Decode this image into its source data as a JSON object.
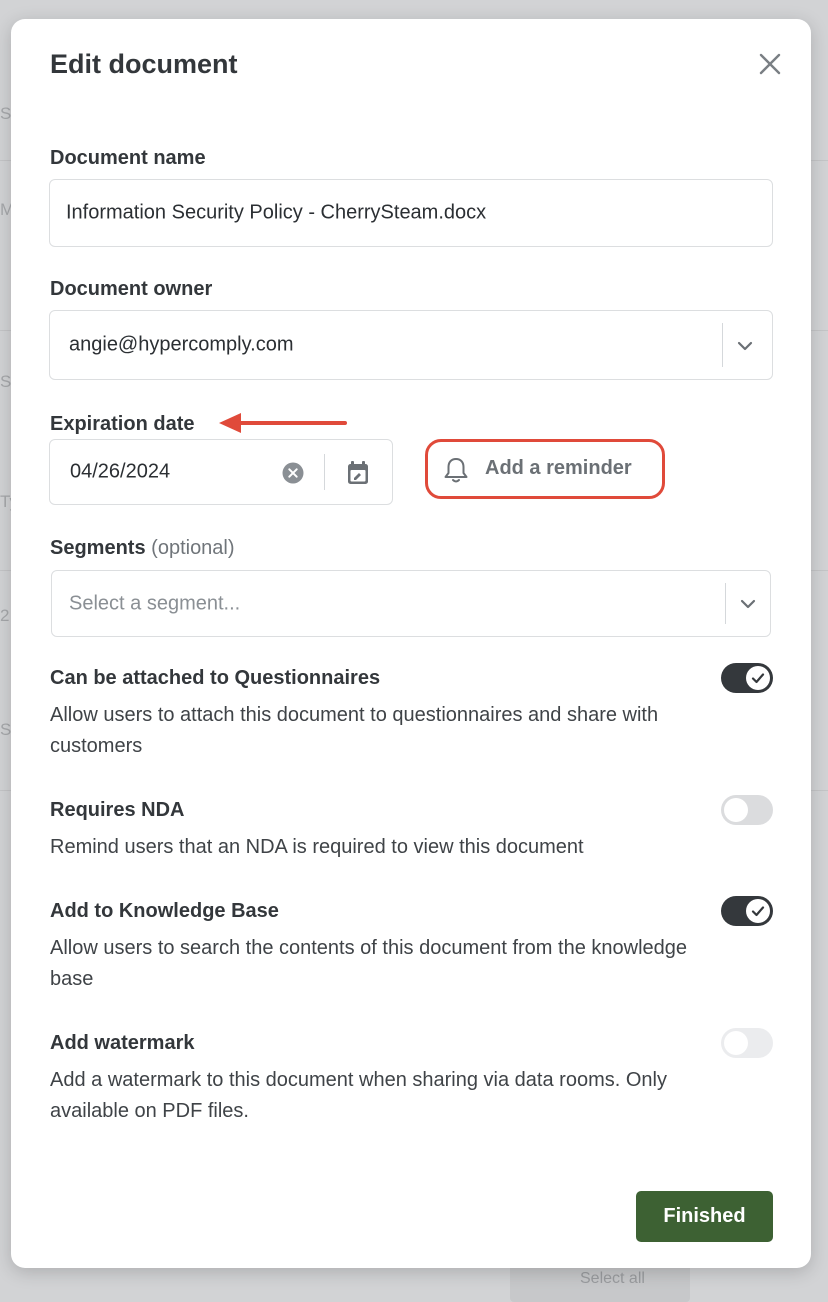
{
  "background": {
    "fragments": [
      "Ser",
      "Ma",
      "Se",
      "Ty",
      "2",
      "Sc",
      "Select all"
    ]
  },
  "modal": {
    "title": "Edit document",
    "close_icon": "close-icon"
  },
  "fields": {
    "document_name": {
      "label": "Document name",
      "value": "Information Security Policy - CherrySteam.docx"
    },
    "document_owner": {
      "label": "Document owner",
      "value": "angie@hypercomply.com"
    },
    "expiration_date": {
      "label": "Expiration date",
      "value": "04/26/2024"
    },
    "reminder": {
      "label": "Add a reminder",
      "icon": "bell-icon"
    },
    "segments": {
      "label": "Segments",
      "optional": "(optional)",
      "placeholder": "Select a segment..."
    }
  },
  "settings": [
    {
      "title": "Can be attached to Questionnaires",
      "description": "Allow users to attach this document to questionnaires and share with customers",
      "state": "on"
    },
    {
      "title": "Requires NDA",
      "description": "Remind users that an NDA is required to view this document",
      "state": "off"
    },
    {
      "title": "Add to Knowledge Base",
      "description": "Allow users to search the contents of this document from the knowledge base",
      "state": "on"
    },
    {
      "title": "Add watermark",
      "description": "Add a watermark to this document when sharing via data rooms. Only available on PDF files.",
      "state": "disabled"
    }
  ],
  "footer": {
    "finished_label": "Finished"
  },
  "colors": {
    "primary_button": "#3d6133",
    "toggle_on": "#34383c",
    "annotation_red": "#e04a3a"
  }
}
